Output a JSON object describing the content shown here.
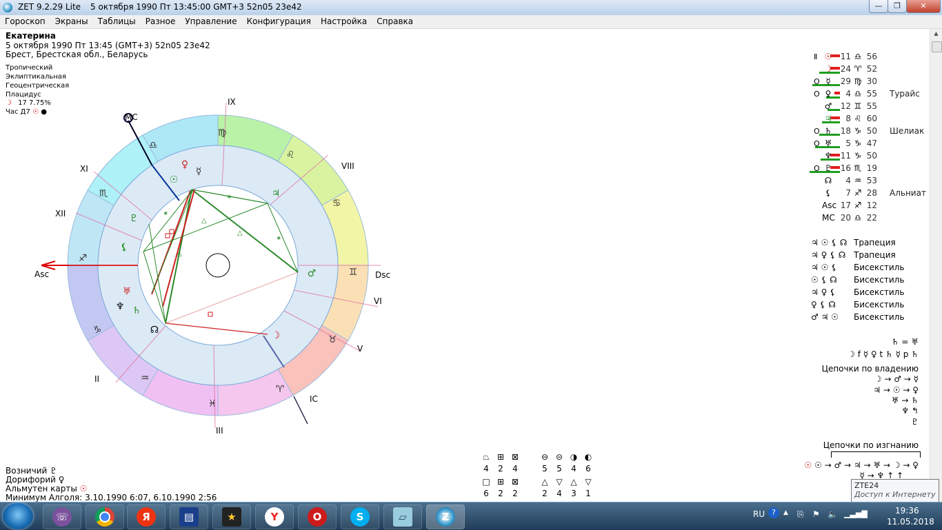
{
  "window": {
    "title": "ZET 9.2.29 Lite",
    "title_info": "5 октября 1990  Пт  13:45:00 GMT+3 52n05  23e42",
    "buttons": [
      "—",
      "❐",
      "✕"
    ]
  },
  "menu": [
    "Гороскоп",
    "Экраны",
    "Таблицы",
    "Разное",
    "Управление",
    "Конфигурация",
    "Настройка",
    "Справка"
  ],
  "header": {
    "name": "Екатерина",
    "date_line": "5 октября 1990  Пт  13:45 (GMT+3) 52n05  23e42",
    "place": "Брест, Брестская обл., Беларусь"
  },
  "settings": [
    "Тропический",
    "Эклиптикальная",
    "Геоцентрическая",
    "Плацидус"
  ],
  "moon_phase": {
    "glyph": "☽",
    "text": "17  7.75%"
  },
  "hour": {
    "label": "Час Д7",
    "glyph": "☉",
    "dot": "●"
  },
  "chart_labels": {
    "mc": "MC",
    "ic": "IC",
    "asc": "Asc",
    "dsc": "Dsc",
    "houses": [
      "IX",
      "VIII",
      "XI",
      "XII",
      "VI",
      "V",
      "II",
      "III"
    ]
  },
  "planets": [
    {
      "sym": "☉",
      "ret": "",
      "prefix": "Ⅱ",
      "deg": "11",
      "sign": "♎",
      "min": "56",
      "star": "",
      "green": 0,
      "red": 14
    },
    {
      "sym": "☽",
      "ret": "",
      "prefix": "",
      "deg": "24",
      "sign": "♈",
      "min": "52",
      "star": "",
      "green": 30,
      "red": 14
    },
    {
      "sym": "☿",
      "ret": "O",
      "prefix": "",
      "deg": "29",
      "sign": "♍",
      "min": "30",
      "star": "",
      "green": 40,
      "red": 0
    },
    {
      "sym": "♀",
      "ret": "O",
      "prefix": "",
      "deg": "4",
      "sign": "♎",
      "min": "55",
      "star": "Турайс",
      "green": 20,
      "red": 8
    },
    {
      "sym": "♂",
      "ret": "",
      "prefix": "",
      "deg": "12",
      "sign": "♊",
      "min": "55",
      "star": "",
      "green": 18,
      "red": 0
    },
    {
      "sym": "♃",
      "ret": "",
      "prefix": "",
      "deg": "8",
      "sign": "♌",
      "min": "60",
      "star": "",
      "green": 26,
      "red": 14
    },
    {
      "sym": "♄",
      "ret": "O",
      "prefix": "",
      "deg": "18",
      "sign": "♑",
      "min": "50",
      "star": "Шелиак",
      "green": 30,
      "red": 0
    },
    {
      "sym": "♅",
      "ret": "O",
      "prefix": "",
      "deg": "5",
      "sign": "♑",
      "min": "47",
      "star": "",
      "green": 36,
      "red": 0
    },
    {
      "sym": "♆",
      "ret": "",
      "prefix": "",
      "deg": "11",
      "sign": "♑",
      "min": "50",
      "star": "",
      "green": 28,
      "red": 14
    },
    {
      "sym": "♇",
      "ret": "O",
      "prefix": "",
      "deg": "16",
      "sign": "♏",
      "min": "19",
      "star": "",
      "green": 44,
      "red": 14
    },
    {
      "sym": "☊",
      "ret": "",
      "prefix": "",
      "deg": "4",
      "sign": "♒",
      "min": "53",
      "star": "",
      "green": 0,
      "red": 0
    },
    {
      "sym": "⚸",
      "ret": "",
      "prefix": "",
      "deg": "7",
      "sign": "♐",
      "min": "28",
      "star": "Альниат",
      "green": 0,
      "red": 0
    },
    {
      "sym": "Asc",
      "ret": "",
      "prefix": "",
      "deg": "17",
      "sign": "♐",
      "min": "12",
      "star": "",
      "green": 0,
      "red": 0
    },
    {
      "sym": "MC",
      "ret": "",
      "prefix": "",
      "deg": "20",
      "sign": "♎",
      "min": "22",
      "star": "",
      "green": 0,
      "red": 0
    }
  ],
  "configurations": [
    {
      "symbols": "♃ ☉ ⚸ ☊",
      "name": "Трапеция"
    },
    {
      "symbols": "♃ ♀ ⚸ ☊",
      "name": "Трапеция"
    },
    {
      "symbols": "♃ ☉ ⚸",
      "name": "Бисекстиль"
    },
    {
      "symbols": "☉ ⚸ ☊",
      "name": "Бисекстиль"
    },
    {
      "symbols": "♃ ♀ ⚸",
      "name": "Бисекстиль"
    },
    {
      "symbols": "♀ ⚸ ☊",
      "name": "Бисекстиль"
    },
    {
      "symbols": "♂ ♃ ☉",
      "name": "Бисекстиль"
    }
  ],
  "reception": {
    "line1": "♄ = ♅",
    "line2": "☽ f ☿ ♀ t ♄ ☿ p ♄",
    "own_title": "Цепочки по владению",
    "own": [
      "☽ → ♂ → ☿",
      "♃ → ☉ → ♀",
      "♅ → ♄",
      "♆ ↰",
      "♇"
    ],
    "exile_title": "Цепочки по изгнанию",
    "exile": [
      "☉ → ♂ → ♃ → ♅ → ☽ → ♀",
      "☿ → ♆ ↑   ↑"
    ]
  },
  "bottom_left": {
    "ruler_label": "Возничий",
    "ruler_sym": "♇",
    "doryphoros_label": "Дорифорий",
    "doryphoros_sym": "♀",
    "almuten_label": "Альмутен карты",
    "almuten_sym": "☉",
    "algol": "Минимум Алголя: 3.10.1990  6:07,  6.10.1990  2:56"
  },
  "stats": {
    "row1_icons": [
      "⏢",
      "⊞",
      "⊠",
      "⊖",
      "⊝",
      "◑",
      "◐"
    ],
    "row1_values": [
      "4",
      "2",
      "4",
      "5",
      "5",
      "4",
      "6"
    ],
    "row2_icons": [
      "□",
      "⊞",
      "⊠",
      "△",
      "▽",
      "△",
      "▽"
    ],
    "row2_values": [
      "6",
      "2",
      "2",
      "2",
      "4",
      "3",
      "1"
    ]
  },
  "tooltip": {
    "title": "ZTE24",
    "text": "Доступ к Интернету"
  },
  "tray": {
    "lang": "RU",
    "time": "19:36",
    "date": "11.05.2018"
  }
}
